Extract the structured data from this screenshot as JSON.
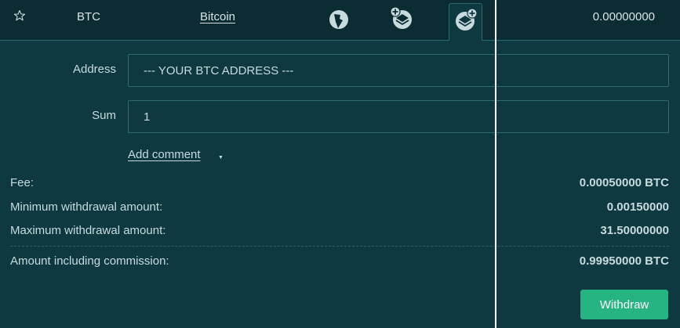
{
  "row": {
    "code": "BTC",
    "name": "Bitcoin",
    "balance": "0.00000000",
    "icons": [
      "star-icon",
      "history-icon",
      "deposit-icon",
      "withdraw-icon"
    ]
  },
  "form": {
    "address_label": "Address",
    "address_placeholder": "--- YOUR BTC ADDRESS ---",
    "sum_label": "Sum",
    "sum_value": "1",
    "add_comment": "Add comment",
    "caret": "▼"
  },
  "info": {
    "fee_label": "Fee:",
    "fee_value": "0.00050000 BTC",
    "min_label": "Minimum withdrawal amount:",
    "min_value": "0.00150000",
    "max_label": "Maximum withdrawal amount:",
    "max_value": "31.50000000",
    "total_label": "Amount including commission:",
    "total_value": "0.99950000 BTC"
  },
  "buttons": {
    "withdraw": "Withdraw"
  },
  "colors": {
    "background": "#0f3940",
    "header": "#0c2c33",
    "accent": "#26b582",
    "border": "#2b6a6c"
  }
}
